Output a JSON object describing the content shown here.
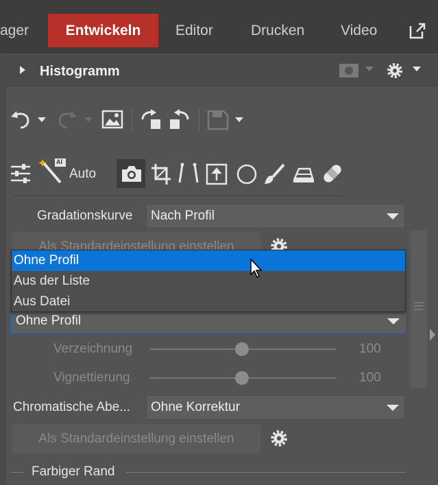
{
  "tabs": [
    {
      "label": "ager"
    },
    {
      "label": "Entwickeln"
    },
    {
      "label": "Editor"
    },
    {
      "label": "Drucken"
    },
    {
      "label": "Video"
    }
  ],
  "histogram": {
    "title": "Histogramm"
  },
  "tools": {
    "auto_label": "Auto",
    "ai_badge": "AI"
  },
  "gradation": {
    "label": "Gradationskurve",
    "value": "Nach Profil"
  },
  "set_default_hidden": "Als Standardeinstellung einstellen",
  "profile_dropdown": {
    "options": [
      "Ohne Profil",
      "Aus der Liste",
      "Aus Datei"
    ],
    "selected_highlight": "Ohne Profil",
    "value": "Ohne Profil"
  },
  "sliders": [
    {
      "label": "Verzeichnung",
      "value": "100",
      "level": 0.5
    },
    {
      "label": "Vignettierung",
      "value": "100",
      "level": 0.5
    }
  ],
  "chromatic": {
    "label": "Chromatische Abe...",
    "value": "Ohne Korrektur"
  },
  "set_default_button": "Als Standardeinstellung einstellen",
  "fringe_section": "Farbiger Rand",
  "colors": {
    "accent_tab": "#b7302a",
    "selection": "#0a74d9"
  }
}
